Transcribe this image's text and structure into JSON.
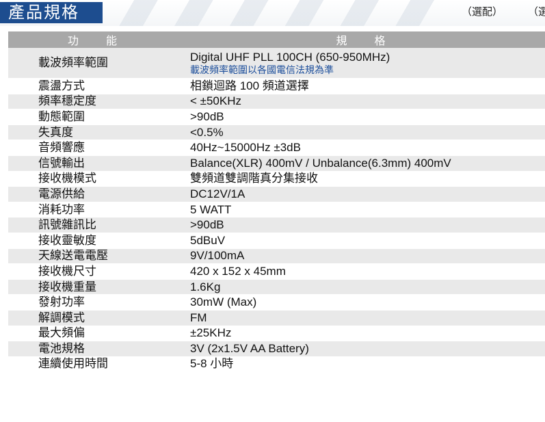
{
  "header": {
    "title": "產品規格",
    "optional_1": "（選配）",
    "optional_2": "（選"
  },
  "table": {
    "col_function": "功　能",
    "col_spec": "規　格",
    "rows": [
      {
        "name": "載波頻率範圍",
        "value": "Digital UHF PLL 100CH (650-950MHz)",
        "note": "載波頻率範圍以各國電信法規為準"
      },
      {
        "name": "震盪方式",
        "value": "相鎖迴路 100 頻道選擇"
      },
      {
        "name": "頻率穩定度",
        "value": "< ±50KHz"
      },
      {
        "name": "動態範圍",
        "value": ">90dB"
      },
      {
        "name": "失真度",
        "value": "<0.5%"
      },
      {
        "name": "音頻響應",
        "value": "40Hz~15000Hz ±3dB"
      },
      {
        "name": "信號輸出",
        "value": "Balance(XLR) 400mV / Unbalance(6.3mm) 400mV"
      },
      {
        "name": "接收機模式",
        "value": "雙頻道雙調階真分集接收"
      },
      {
        "name": "電源供給",
        "value": "DC12V/1A"
      },
      {
        "name": "消耗功率",
        "value": "5 WATT"
      },
      {
        "name": "訊號雜訊比",
        "value": ">90dB"
      },
      {
        "name": "接收靈敏度",
        "value": "5dBuV"
      },
      {
        "name": "天線送電電壓",
        "value": "9V/100mA"
      },
      {
        "name": "接收機尺寸",
        "value": "420 x 152 x 45mm"
      },
      {
        "name": "接收機重量",
        "value": "1.6Kg"
      },
      {
        "name": "發射功率",
        "value": "30mW (Max)"
      },
      {
        "name": "解調模式",
        "value": "FM"
      },
      {
        "name": "最大頻偏",
        "value": "±25KHz"
      },
      {
        "name": "電池規格",
        "value": "3V (2x1.5V AA Battery)"
      },
      {
        "name": "連續使用時間",
        "value": "5-8 小時"
      }
    ]
  },
  "colors": {
    "title_bg": "#1d4d8f",
    "header_row_bg": "#a8a8a8",
    "stripe_bg": "#e9e9e9",
    "note_text": "#1c4e9b"
  }
}
